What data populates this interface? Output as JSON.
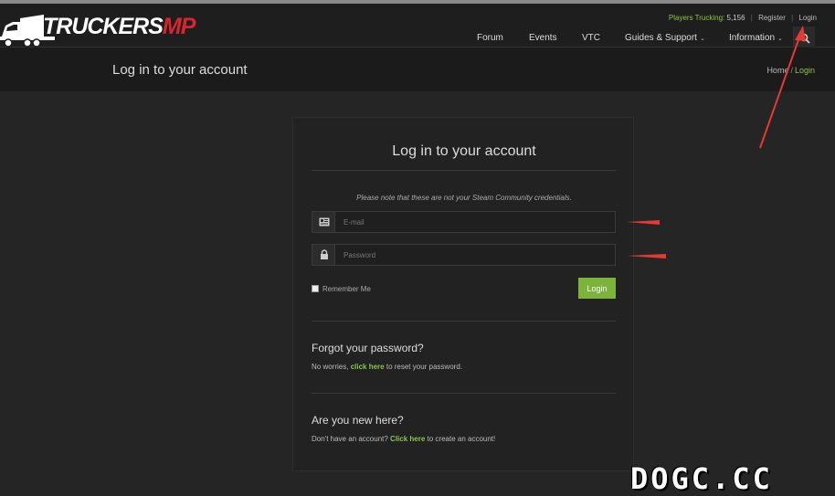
{
  "header": {
    "logo_main": "TRUCKERS",
    "logo_accent": "MP",
    "players_label": "Players Trucking:",
    "players_count": "5,156",
    "register_label": "Register",
    "login_label": "Login",
    "nav": [
      {
        "label": "Forum",
        "has_dropdown": false
      },
      {
        "label": "Events",
        "has_dropdown": false
      },
      {
        "label": "VTC",
        "has_dropdown": false
      },
      {
        "label": "Guides & Support",
        "has_dropdown": true
      },
      {
        "label": "Information",
        "has_dropdown": true
      }
    ],
    "search_icon": "search-icon"
  },
  "subheader": {
    "title": "Log in to your account",
    "breadcrumb": [
      {
        "label": "Home"
      },
      {
        "label": "Login",
        "active": true
      }
    ]
  },
  "login_form": {
    "title": "Log in to your account",
    "note": "Please note that these are not your Steam Community credentials.",
    "email": {
      "placeholder": "E-mail",
      "value": "",
      "icon": "id-card-icon"
    },
    "password": {
      "placeholder": "Password",
      "value": "",
      "icon": "lock-icon"
    },
    "remember_label": "Remember Me",
    "remember_checked": false,
    "submit_label": "Login"
  },
  "forgot": {
    "title": "Forgot your password?",
    "text_before": "No worries,",
    "link": "click here",
    "text_after": "to reset your password."
  },
  "signup": {
    "title": "Are you new here?",
    "text_before": "Don't have an account?",
    "link": "Click here",
    "text_after": "to create an account!"
  },
  "watermark": "DOGC.CC",
  "colors": {
    "accent_green": "#8bc34a",
    "button_green": "#7cb33a",
    "logo_red": "#d9262e",
    "annotation_red": "#e53935",
    "background": "#252525"
  }
}
